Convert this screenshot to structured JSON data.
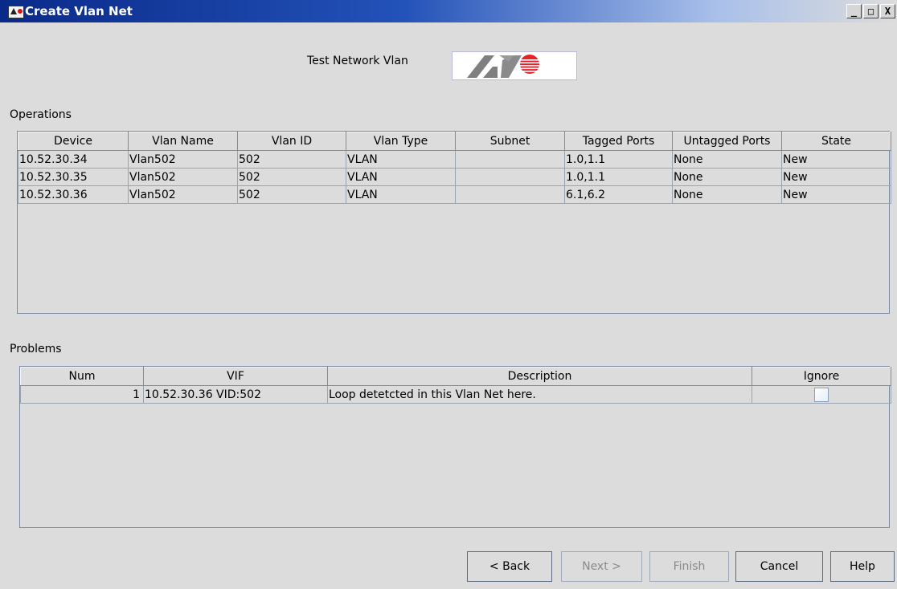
{
  "window": {
    "title": "Create Vlan Net",
    "controls": {
      "minimize": "_",
      "maximize": "□",
      "close": "X"
    }
  },
  "header": {
    "label": "Test Network Vlan",
    "logo_icon": "allied-telesyn-logo",
    "logo_colors": {
      "mark": "#808080",
      "sphere": "#e8202a"
    }
  },
  "operations": {
    "label": "Operations",
    "columns": [
      "Device",
      "Vlan Name",
      "Vlan ID",
      "Vlan Type",
      "Subnet",
      "Tagged Ports",
      "Untagged Ports",
      "State"
    ],
    "rows": [
      [
        "10.52.30.34",
        "Vlan502",
        "502",
        "VLAN",
        "",
        "1.0,1.1",
        "None",
        "New"
      ],
      [
        "10.52.30.35",
        "Vlan502",
        "502",
        "VLAN",
        "",
        "1.0,1.1",
        "None",
        "New"
      ],
      [
        "10.52.30.36",
        "Vlan502",
        "502",
        "VLAN",
        "",
        "6.1,6.2",
        "None",
        "New"
      ]
    ]
  },
  "problems": {
    "label": "Problems",
    "columns": [
      "Num",
      "VIF",
      "Description",
      "Ignore"
    ],
    "rows": [
      {
        "num": "1",
        "vif": "10.52.30.36 VID:502",
        "description": "Loop detetcted in this Vlan Net here.",
        "ignore": false
      }
    ]
  },
  "buttons": {
    "back": "< Back",
    "next": "Next >",
    "finish": "Finish",
    "cancel": "Cancel",
    "help": "Help"
  }
}
